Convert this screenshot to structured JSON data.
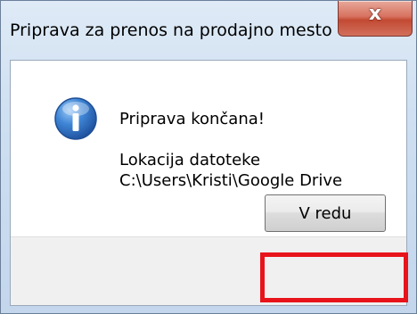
{
  "dialog": {
    "title": "Priprava za prenos na prodajno mesto",
    "close_symbol": "x",
    "icon": "info-icon",
    "message": {
      "headline": "Priprava končana!",
      "location_label": "Lokacija datoteke",
      "location_path": "C:\\Users\\Kristi\\Google Drive"
    },
    "ok_label": "V redu"
  },
  "colors": {
    "highlight": "#e8141b",
    "close_button": "#c24a33",
    "info_icon": "#2f6fc4"
  }
}
